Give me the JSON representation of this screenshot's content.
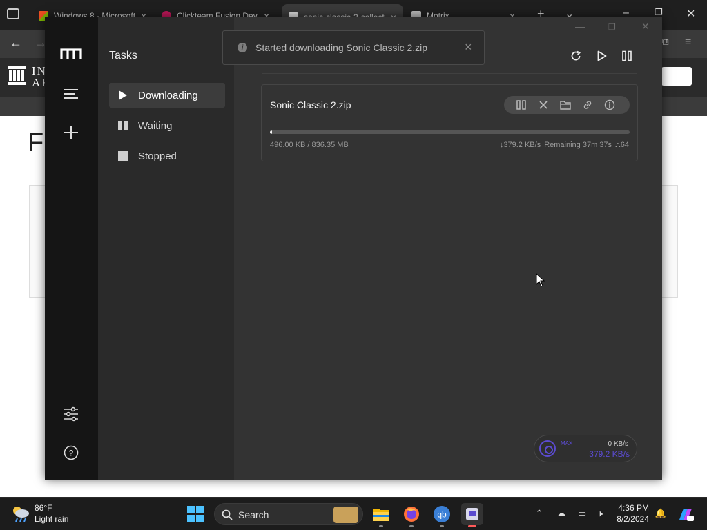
{
  "browser": {
    "tabs": [
      {
        "title": "Windows 8 - Microsoft",
        "color": "#2a7de1"
      },
      {
        "title": "Clickteam Fusion Deve",
        "color": "#c2185b"
      },
      {
        "title": "sonic-classic-2-collect",
        "color": "#9e9e9e"
      },
      {
        "title": "Motrix",
        "color": "#bdbdbd"
      }
    ],
    "tab_close": "×",
    "new_tab": "+",
    "site_logo_lines": [
      "IN",
      "AR"
    ],
    "site_heading_letter": "F"
  },
  "app": {
    "name": "Motrix",
    "sidebar_title": "Tasks",
    "nav": [
      {
        "label": "Downloading",
        "icon": "play-icon",
        "active": true
      },
      {
        "label": "Waiting",
        "icon": "pause-icon",
        "active": false
      },
      {
        "label": "Stopped",
        "icon": "stop-icon",
        "active": false
      }
    ],
    "rail_icons": [
      "menu-icon",
      "add-icon",
      "settings-icon",
      "help-icon"
    ],
    "toolbar_icons": [
      "refresh-icon",
      "resume-all-icon",
      "pause-all-icon"
    ],
    "toast": {
      "message": "Started downloading Sonic Classic 2.zip",
      "close": "×"
    },
    "task": {
      "name": "Sonic Classic 2.zip",
      "progress": 0.006,
      "size_text": "496.00 KB / 836.35 MB",
      "speed": "↓379.2 KB/s",
      "remaining": "Remaining 37m 37s",
      "connections": "64",
      "actions": [
        "pause-icon",
        "delete-icon",
        "folder-icon",
        "link-icon",
        "info-icon"
      ]
    },
    "speedometer": {
      "max_label": "MAX",
      "upload": "0 KB/s",
      "download": "379.2 KB/s",
      "accent": "#5b4bd0"
    }
  },
  "taskbar": {
    "weather_temp": "86°F",
    "weather_desc": "Light rain",
    "search_label": "Search",
    "time": "4:36 PM",
    "date": "8/2/2024"
  }
}
